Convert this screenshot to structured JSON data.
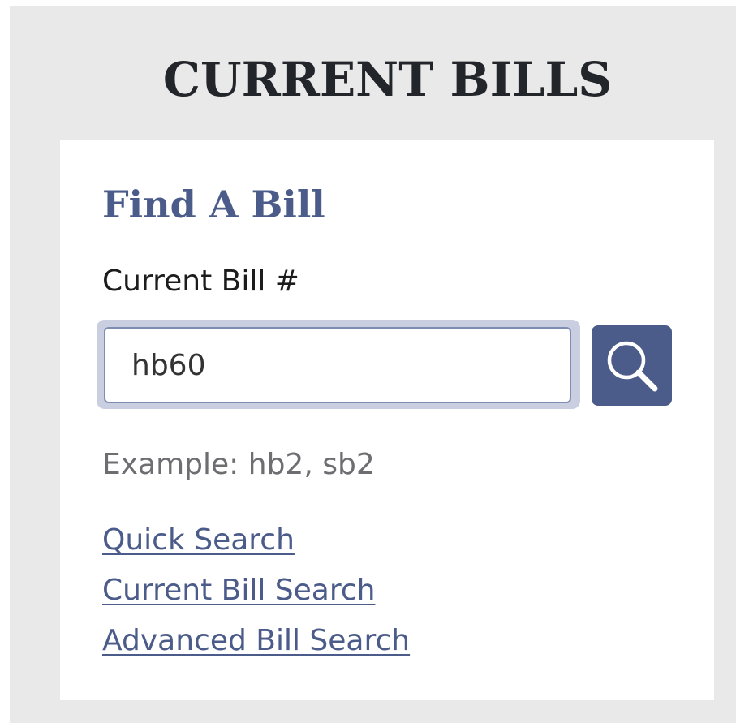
{
  "header": {
    "title": "CURRENT BILLS"
  },
  "find_bill": {
    "title": "Find A Bill",
    "field_label": "Current Bill #",
    "input_value": "hb60",
    "search_button_icon": "search-icon",
    "example": "Example: hb2, sb2"
  },
  "links": [
    {
      "label": "Quick Search"
    },
    {
      "label": "Current Bill Search"
    },
    {
      "label": "Advanced Bill Search"
    }
  ],
  "colors": {
    "accent": "#4b5b8a",
    "background": "#e9e9e9",
    "card": "#ffffff",
    "title_text": "#222529",
    "muted_text": "#6e6e72"
  }
}
